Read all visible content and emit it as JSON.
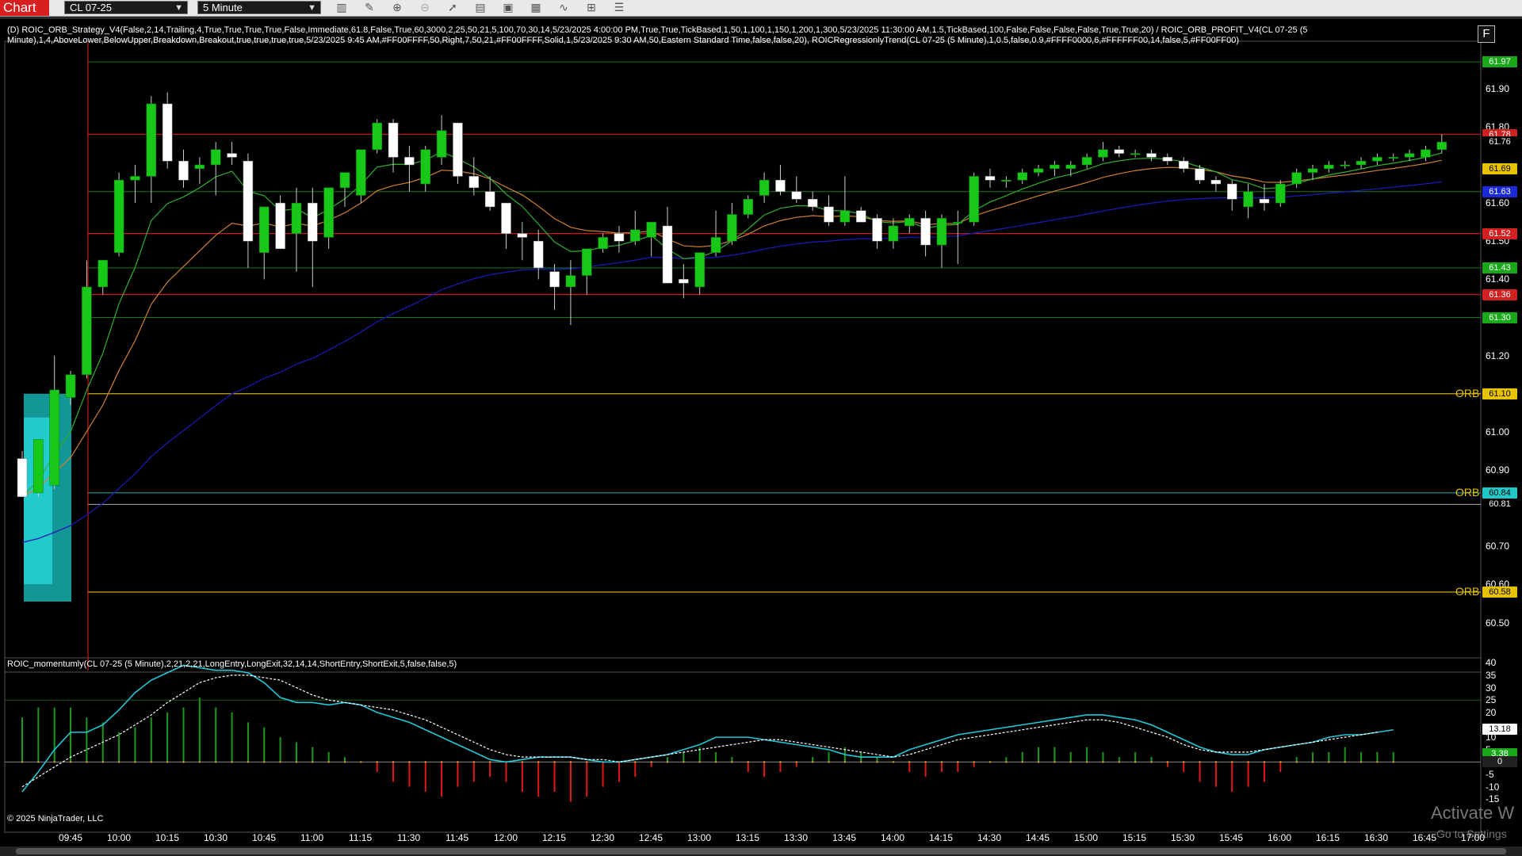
{
  "toolbar": {
    "chart_tab": "Chart",
    "instrument": "CL 07-25",
    "interval": "5 Minute",
    "icons": [
      "bar-type-icon",
      "pencil-icon",
      "zoom-icon",
      "zoom-out-icon",
      "pointer-icon",
      "data-box-icon",
      "properties-icon",
      "indicators-icon",
      "strategies-icon",
      "templates-icon",
      "menu-icon"
    ]
  },
  "indicator_label": "(D) ROIC_ORB_Strategy_V4(False,2,14,Trailing,4,True,True,True,True,False,Immediate,61.8,False,True,60,3000,2,25,50,21,5,100,70,30,14,5/23/2025 4:00:00 PM,True,True,TickBased,1,50,1,100,1,150,1,200,1,300,5/23/2025 11:30:00 AM,1.5,TickBased,100,False,False,False,False,True,True,20) / ROIC_ORB_PROFIT_V4(CL 07-25 (5 Minute),1,4,AboveLower,BelowUpper,Breakdown,Breakout,true,true,true,true,5/23/2025 9:45 AM,#FF00FFFF,50,Right,7,50,21,#FF00FFFF,Solid,1,5/23/2025 9:30 AM,50,Eastern Standard Time,false,false,20), ROICRegressionlyTrend(CL 07-25 (5 Minute),1,0.5,false,0.9,#FFFF0000,6,#FFFFFF00,14,false,5,#FF00FF00)",
  "momentum_label": "ROIC_momentumly(CL 07-25 (5 Minute),2,21,2,21,LongEntry,LongExit,32,14,14,ShortEntry,ShortExit,5,false,false,5)",
  "copyright": "© 2025 NinjaTrader, LLC",
  "f_button": "F",
  "watermark": {
    "line1": "Activate W",
    "line2": "Go to Settings"
  },
  "price_axis": {
    "range": [
      60.42,
      62.02
    ],
    "ticks": [
      "61.90",
      "61.80",
      "61.60",
      "61.50",
      "61.40",
      "61.20",
      "61.00",
      "60.90",
      "60.70",
      "60.60",
      "60.50"
    ],
    "tags": [
      {
        "text": "61.97",
        "bg": "#18a818",
        "fg": "#ffffff",
        "y": 61.97
      },
      {
        "text": "61.78",
        "bg": "#d02020",
        "fg": "#ffffff",
        "y": 61.78
      },
      {
        "text": "61.76",
        "bg": "#000000",
        "fg": "#ffffff",
        "y": 61.76
      },
      {
        "text": "61.69",
        "bg": "#e6c200",
        "fg": "#000000",
        "y": 61.69
      },
      {
        "text": "61.63",
        "bg": "#1a2ad8",
        "fg": "#ffffff",
        "y": 61.63
      },
      {
        "text": "61.52",
        "bg": "#d02020",
        "fg": "#ffffff",
        "y": 61.52
      },
      {
        "text": "61.43",
        "bg": "#18a818",
        "fg": "#ffffff",
        "y": 61.43
      },
      {
        "text": "61.36",
        "bg": "#d02020",
        "fg": "#ffffff",
        "y": 61.36
      },
      {
        "text": "61.30",
        "bg": "#18a818",
        "fg": "#ffffff",
        "y": 61.3
      },
      {
        "text": "61.10",
        "bg": "#e6c200",
        "fg": "#000000",
        "y": 61.1
      },
      {
        "text": "60.84",
        "bg": "#20c8c8",
        "fg": "#000000",
        "y": 60.84
      },
      {
        "text": "60.81",
        "bg": "#000000",
        "fg": "#ffffff",
        "y": 60.81
      },
      {
        "text": "60.58",
        "bg": "#e6c200",
        "fg": "#000000",
        "y": 60.58
      }
    ],
    "orb_labels": [
      {
        "text": "ORB",
        "y": 61.1
      },
      {
        "text": "ORB",
        "y": 60.84
      },
      {
        "text": "ORB",
        "y": 60.58
      }
    ]
  },
  "momentum_axis": {
    "range": [
      -20,
      42
    ],
    "ticks": [
      "40",
      "35",
      "30",
      "25",
      "20",
      "10",
      "5",
      "0",
      "-5",
      "-10",
      "-15"
    ],
    "tags": [
      {
        "text": "13.18",
        "bg": "#ffffff",
        "fg": "#000000",
        "y": 13.18
      },
      {
        "text": "3.38",
        "bg": "#18a818",
        "fg": "#ffffff",
        "y": 3.38
      },
      {
        "text": "0",
        "bg": "#222222",
        "fg": "#ffffff",
        "y": 0
      }
    ]
  },
  "time_axis": [
    "09:45",
    "10:00",
    "10:15",
    "10:30",
    "10:45",
    "11:00",
    "11:15",
    "11:30",
    "11:45",
    "12:00",
    "12:15",
    "12:30",
    "12:45",
    "13:00",
    "13:15",
    "13:30",
    "13:45",
    "14:00",
    "14:15",
    "14:30",
    "14:45",
    "15:00",
    "15:15",
    "15:30",
    "15:45",
    "16:00",
    "16:15",
    "16:30",
    "16:45",
    "17:00"
  ],
  "colors": {
    "up_candle": "#18c818",
    "down_candle": "#ffffff",
    "orb_box": "#18c8c8",
    "red_line": "#c81818",
    "green_line": "#187818",
    "yellow_line": "#c8a818",
    "blue_ma": "#1a1ab0",
    "orange_ma": "#d08030",
    "green_ma": "#30b030",
    "momentum_cyan": "#20c8d8",
    "momentum_white": "#ffffff"
  },
  "chart_data": {
    "type": "candlestick",
    "timeframe": "5 Minute",
    "instrument": "CL 07-25",
    "orb": {
      "high": 61.1,
      "mid": 60.84,
      "low": 60.58
    },
    "levels": {
      "red": [
        61.78,
        61.52,
        61.36
      ],
      "green": [
        61.97,
        61.63,
        61.43,
        61.3
      ]
    },
    "candles": [
      {
        "t": "09:35",
        "o": 60.93,
        "h": 60.95,
        "l": 60.83,
        "c": 60.83
      },
      {
        "t": "09:40",
        "o": 60.84,
        "h": 60.98,
        "l": 60.83,
        "c": 60.98
      },
      {
        "t": "09:45",
        "o": 60.86,
        "h": 61.2,
        "l": 60.85,
        "c": 61.11
      },
      {
        "t": "09:50",
        "o": 61.09,
        "h": 61.16,
        "l": 61.07,
        "c": 61.15
      },
      {
        "t": "09:55",
        "o": 61.15,
        "h": 61.45,
        "l": 61.14,
        "c": 61.38
      },
      {
        "t": "10:00",
        "o": 61.38,
        "h": 61.45,
        "l": 61.36,
        "c": 61.45
      },
      {
        "t": "10:05",
        "o": 61.47,
        "h": 61.68,
        "l": 61.46,
        "c": 61.66
      },
      {
        "t": "10:10",
        "o": 61.66,
        "h": 61.7,
        "l": 61.6,
        "c": 61.67
      },
      {
        "t": "10:15",
        "o": 61.67,
        "h": 61.88,
        "l": 61.6,
        "c": 61.86
      },
      {
        "t": "10:20",
        "o": 61.86,
        "h": 61.89,
        "l": 61.69,
        "c": 61.71
      },
      {
        "t": "10:25",
        "o": 61.71,
        "h": 61.74,
        "l": 61.64,
        "c": 61.66
      },
      {
        "t": "10:30",
        "o": 61.69,
        "h": 61.72,
        "l": 61.65,
        "c": 61.7
      },
      {
        "t": "10:35",
        "o": 61.7,
        "h": 61.76,
        "l": 61.62,
        "c": 61.74
      },
      {
        "t": "10:40",
        "o": 61.73,
        "h": 61.76,
        "l": 61.7,
        "c": 61.72
      },
      {
        "t": "10:45",
        "o": 61.71,
        "h": 61.73,
        "l": 61.43,
        "c": 61.5
      },
      {
        "t": "10:50",
        "o": 61.47,
        "h": 61.56,
        "l": 61.4,
        "c": 61.59
      },
      {
        "t": "10:55",
        "o": 61.6,
        "h": 61.62,
        "l": 61.48,
        "c": 61.48
      },
      {
        "t": "11:00",
        "o": 61.52,
        "h": 61.64,
        "l": 61.42,
        "c": 61.6
      },
      {
        "t": "11:05",
        "o": 61.6,
        "h": 61.64,
        "l": 61.38,
        "c": 61.5
      },
      {
        "t": "11:10",
        "o": 61.51,
        "h": 61.64,
        "l": 61.48,
        "c": 61.64
      },
      {
        "t": "11:15",
        "o": 61.64,
        "h": 61.68,
        "l": 61.59,
        "c": 61.68
      },
      {
        "t": "11:20",
        "o": 61.62,
        "h": 61.74,
        "l": 61.6,
        "c": 61.74
      },
      {
        "t": "11:25",
        "o": 61.74,
        "h": 61.82,
        "l": 61.73,
        "c": 61.81
      },
      {
        "t": "11:30",
        "o": 61.81,
        "h": 61.82,
        "l": 61.68,
        "c": 61.72
      },
      {
        "t": "11:35",
        "o": 61.72,
        "h": 61.75,
        "l": 61.63,
        "c": 61.7
      },
      {
        "t": "11:40",
        "o": 61.65,
        "h": 61.75,
        "l": 61.63,
        "c": 61.74
      },
      {
        "t": "11:45",
        "o": 61.72,
        "h": 61.83,
        "l": 61.7,
        "c": 61.79
      },
      {
        "t": "11:50",
        "o": 61.81,
        "h": 61.81,
        "l": 61.65,
        "c": 61.67
      },
      {
        "t": "11:55",
        "o": 61.67,
        "h": 61.72,
        "l": 61.62,
        "c": 61.64
      },
      {
        "t": "12:00",
        "o": 61.63,
        "h": 61.67,
        "l": 61.58,
        "c": 61.59
      },
      {
        "t": "12:05",
        "o": 61.6,
        "h": 61.6,
        "l": 61.48,
        "c": 61.52
      },
      {
        "t": "12:10",
        "o": 61.52,
        "h": 61.55,
        "l": 61.45,
        "c": 61.51
      },
      {
        "t": "12:15",
        "o": 61.5,
        "h": 61.53,
        "l": 61.4,
        "c": 61.43
      },
      {
        "t": "12:20",
        "o": 61.42,
        "h": 61.44,
        "l": 61.32,
        "c": 61.38
      },
      {
        "t": "12:25",
        "o": 61.38,
        "h": 61.45,
        "l": 61.28,
        "c": 61.41
      },
      {
        "t": "12:30",
        "o": 61.41,
        "h": 61.48,
        "l": 61.36,
        "c": 61.48
      },
      {
        "t": "12:35",
        "o": 61.48,
        "h": 61.52,
        "l": 61.47,
        "c": 61.51
      },
      {
        "t": "12:40",
        "o": 61.52,
        "h": 61.54,
        "l": 61.47,
        "c": 61.5
      },
      {
        "t": "12:45",
        "o": 61.5,
        "h": 61.58,
        "l": 61.49,
        "c": 61.53
      },
      {
        "t": "12:50",
        "o": 61.51,
        "h": 61.55,
        "l": 61.46,
        "c": 61.55
      },
      {
        "t": "12:55",
        "o": 61.54,
        "h": 61.59,
        "l": 61.39,
        "c": 61.39
      },
      {
        "t": "13:00",
        "o": 61.4,
        "h": 61.44,
        "l": 61.35,
        "c": 61.39
      },
      {
        "t": "13:05",
        "o": 61.38,
        "h": 61.47,
        "l": 61.36,
        "c": 61.47
      },
      {
        "t": "13:10",
        "o": 61.47,
        "h": 61.58,
        "l": 61.46,
        "c": 61.51
      },
      {
        "t": "13:15",
        "o": 61.5,
        "h": 61.6,
        "l": 61.49,
        "c": 61.57
      },
      {
        "t": "13:20",
        "o": 61.57,
        "h": 61.62,
        "l": 61.56,
        "c": 61.61
      },
      {
        "t": "13:25",
        "o": 61.62,
        "h": 61.68,
        "l": 61.6,
        "c": 61.66
      },
      {
        "t": "13:30",
        "o": 61.66,
        "h": 61.7,
        "l": 61.62,
        "c": 61.63
      },
      {
        "t": "13:35",
        "o": 61.63,
        "h": 61.67,
        "l": 61.6,
        "c": 61.61
      },
      {
        "t": "13:40",
        "o": 61.61,
        "h": 61.63,
        "l": 61.58,
        "c": 61.59
      },
      {
        "t": "13:45",
        "o": 61.59,
        "h": 61.62,
        "l": 61.54,
        "c": 61.55
      },
      {
        "t": "13:50",
        "o": 61.55,
        "h": 61.67,
        "l": 61.54,
        "c": 61.58
      },
      {
        "t": "13:55",
        "o": 61.58,
        "h": 61.59,
        "l": 61.55,
        "c": 61.55
      },
      {
        "t": "14:00",
        "o": 61.56,
        "h": 61.57,
        "l": 61.48,
        "c": 61.5
      },
      {
        "t": "14:05",
        "o": 61.5,
        "h": 61.56,
        "l": 61.48,
        "c": 61.54
      },
      {
        "t": "14:10",
        "o": 61.54,
        "h": 61.57,
        "l": 61.52,
        "c": 61.56
      },
      {
        "t": "14:15",
        "o": 61.56,
        "h": 61.58,
        "l": 61.46,
        "c": 61.49
      },
      {
        "t": "14:20",
        "o": 61.49,
        "h": 61.57,
        "l": 61.43,
        "c": 61.56
      },
      {
        "t": "14:25",
        "o": 61.55,
        "h": 61.58,
        "l": 61.44,
        "c": 61.55
      },
      {
        "t": "14:30",
        "o": 61.55,
        "h": 61.68,
        "l": 61.54,
        "c": 61.67
      },
      {
        "t": "14:35",
        "o": 61.67,
        "h": 61.69,
        "l": 61.64,
        "c": 61.66
      },
      {
        "t": "14:40",
        "o": 61.66,
        "h": 61.67,
        "l": 61.64,
        "c": 61.66
      },
      {
        "t": "14:45",
        "o": 61.66,
        "h": 61.69,
        "l": 61.65,
        "c": 61.68
      },
      {
        "t": "14:50",
        "o": 61.68,
        "h": 61.7,
        "l": 61.67,
        "c": 61.69
      },
      {
        "t": "14:55",
        "o": 61.69,
        "h": 61.71,
        "l": 61.67,
        "c": 61.7
      },
      {
        "t": "15:00",
        "o": 61.69,
        "h": 61.71,
        "l": 61.67,
        "c": 61.7
      },
      {
        "t": "15:05",
        "o": 61.7,
        "h": 61.73,
        "l": 61.69,
        "c": 61.72
      },
      {
        "t": "15:10",
        "o": 61.72,
        "h": 61.76,
        "l": 61.71,
        "c": 61.74
      },
      {
        "t": "15:15",
        "o": 61.74,
        "h": 61.75,
        "l": 61.72,
        "c": 61.73
      },
      {
        "t": "15:20",
        "o": 61.73,
        "h": 61.74,
        "l": 61.72,
        "c": 61.73
      },
      {
        "t": "15:25",
        "o": 61.73,
        "h": 61.74,
        "l": 61.71,
        "c": 61.72
      },
      {
        "t": "15:30",
        "o": 61.72,
        "h": 61.73,
        "l": 61.7,
        "c": 61.71
      },
      {
        "t": "15:35",
        "o": 61.71,
        "h": 61.72,
        "l": 61.68,
        "c": 61.69
      },
      {
        "t": "15:40",
        "o": 61.69,
        "h": 61.7,
        "l": 61.65,
        "c": 61.66
      },
      {
        "t": "15:45",
        "o": 61.66,
        "h": 61.67,
        "l": 61.63,
        "c": 61.65
      },
      {
        "t": "15:50",
        "o": 61.65,
        "h": 61.66,
        "l": 61.58,
        "c": 61.61
      },
      {
        "t": "15:55",
        "o": 61.59,
        "h": 61.65,
        "l": 61.56,
        "c": 61.63
      },
      {
        "t": "16:00",
        "o": 61.61,
        "h": 61.65,
        "l": 61.58,
        "c": 61.6
      },
      {
        "t": "16:05",
        "o": 61.6,
        "h": 61.66,
        "l": 61.59,
        "c": 61.65
      },
      {
        "t": "16:10",
        "o": 61.65,
        "h": 61.69,
        "l": 61.64,
        "c": 61.68
      },
      {
        "t": "16:15",
        "o": 61.68,
        "h": 61.7,
        "l": 61.66,
        "c": 61.69
      },
      {
        "t": "16:20",
        "o": 61.69,
        "h": 61.71,
        "l": 61.68,
        "c": 61.7
      },
      {
        "t": "16:25",
        "o": 61.7,
        "h": 61.71,
        "l": 61.69,
        "c": 61.7
      },
      {
        "t": "16:30",
        "o": 61.7,
        "h": 61.72,
        "l": 61.69,
        "c": 61.71
      },
      {
        "t": "16:35",
        "o": 61.71,
        "h": 61.73,
        "l": 61.7,
        "c": 61.72
      },
      {
        "t": "16:40",
        "o": 61.72,
        "h": 61.73,
        "l": 61.71,
        "c": 61.72
      },
      {
        "t": "16:45",
        "o": 61.72,
        "h": 61.74,
        "l": 61.71,
        "c": 61.73
      },
      {
        "t": "16:50",
        "o": 61.72,
        "h": 61.75,
        "l": 61.71,
        "c": 61.74
      },
      {
        "t": "16:55",
        "o": 61.74,
        "h": 61.78,
        "l": 61.73,
        "c": 61.76
      }
    ],
    "momentum": {
      "cyan": [
        -12,
        -4,
        5,
        12,
        12,
        15,
        21,
        28,
        33,
        36,
        39,
        38,
        37,
        37,
        36,
        32,
        26,
        24,
        24,
        23,
        24,
        23,
        20,
        18,
        16,
        13,
        10,
        7,
        4,
        1,
        0,
        1,
        2,
        2,
        2,
        1,
        0,
        0,
        1,
        2,
        3,
        5,
        7,
        10,
        10,
        10,
        9,
        8,
        7,
        6,
        5,
        3,
        2,
        2,
        2,
        5,
        7,
        9,
        11,
        12,
        13,
        14,
        15,
        16,
        17,
        18,
        19,
        19,
        18,
        17,
        15,
        12,
        9,
        6,
        4,
        3,
        3,
        5,
        6,
        7,
        8,
        10,
        11,
        11,
        12,
        13
      ],
      "white": [
        -10,
        -6,
        -2,
        2,
        5,
        8,
        11,
        15,
        19,
        24,
        28,
        32,
        34,
        35,
        35,
        34,
        33,
        30,
        27,
        25,
        24,
        23,
        22,
        21,
        19,
        17,
        14,
        11,
        8,
        5,
        3,
        2,
        2,
        2,
        2,
        1,
        1,
        0,
        1,
        2,
        3,
        4,
        5,
        6,
        7,
        8,
        9,
        9,
        8,
        7,
        6,
        5,
        4,
        3,
        2,
        3,
        5,
        7,
        9,
        10,
        11,
        12,
        13,
        14,
        15,
        16,
        17,
        17,
        16,
        14,
        12,
        10,
        7,
        5,
        4,
        4,
        4,
        5,
        6,
        7,
        8,
        9,
        10,
        11,
        12
      ],
      "hist": [
        18,
        22,
        22,
        22,
        18,
        16,
        12,
        14,
        18,
        20,
        22,
        26,
        22,
        20,
        16,
        14,
        10,
        8,
        6,
        4,
        2,
        0,
        -4,
        -8,
        -10,
        -12,
        -14,
        -10,
        -8,
        -6,
        -8,
        -12,
        -14,
        -12,
        -16,
        -14,
        -10,
        -8,
        -6,
        -2,
        2,
        4,
        6,
        4,
        2,
        -4,
        -6,
        -4,
        -2,
        2,
        4,
        6,
        4,
        2,
        0,
        -4,
        -6,
        -4,
        -4,
        -2,
        0,
        2,
        4,
        6,
        6,
        4,
        6,
        4,
        2,
        4,
        2,
        -2,
        -4,
        -8,
        -10,
        -12,
        -10,
        -8,
        -4,
        2,
        4,
        4,
        6,
        4,
        4,
        4
      ]
    }
  }
}
